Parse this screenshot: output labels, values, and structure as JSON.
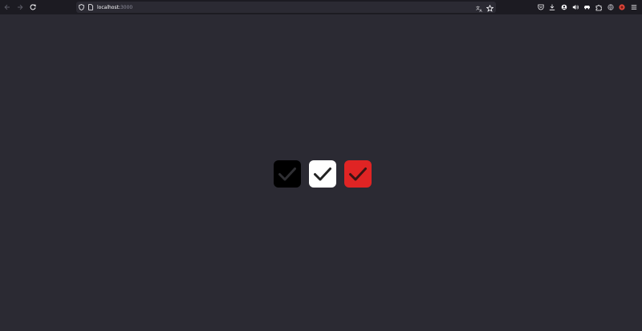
{
  "browser": {
    "url_host": "localhost:",
    "url_port": "3000"
  },
  "icons": {
    "back": "arrow-left-icon",
    "forward": "arrow-right-icon",
    "reload": "reload-icon",
    "site_info": "shield-icon",
    "page": "page-icon",
    "translate": "translate-icon",
    "bookmark": "star-icon",
    "pocket": "pocket-icon",
    "downloads": "download-icon",
    "account": "account-icon",
    "media": "speaker-icon",
    "extension_a": "car-icon",
    "extensions": "puzzle-icon",
    "extension_b": "globe-icon",
    "extension_c": "red-badge-icon",
    "menu": "hamburger-menu-icon"
  },
  "checkboxes": [
    {
      "checked": true,
      "background": "#000000",
      "checkmark": "#2f2f33",
      "style": "black"
    },
    {
      "checked": true,
      "background": "#ffffff",
      "checkmark": "#222222",
      "style": "white"
    },
    {
      "checked": true,
      "background": "#e02424",
      "checkmark": "#3a1414",
      "style": "red"
    }
  ],
  "colors": {
    "page_background": "#2b2a33",
    "toolbar_background": "#1c1b22"
  }
}
